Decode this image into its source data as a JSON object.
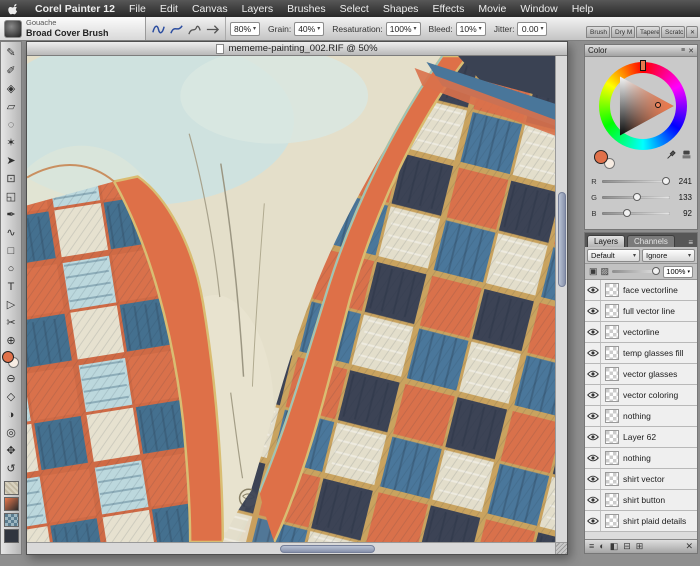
{
  "menu_bar": {
    "app_name": "Corel Painter 12",
    "items": [
      "File",
      "Edit",
      "Canvas",
      "Layers",
      "Brushes",
      "Select",
      "Shapes",
      "Effects",
      "Movie",
      "Window",
      "Help"
    ]
  },
  "property_bar": {
    "brush_category": "Gouache",
    "brush_name": "Broad Cover Brush",
    "controls": [
      {
        "label": "",
        "value": "80%"
      },
      {
        "label": "Grain:",
        "value": "40%"
      },
      {
        "label": "Resaturation:",
        "value": "100%"
      },
      {
        "label": "Bleed:",
        "value": "10%"
      },
      {
        "label": "Jitter:",
        "value": "0.00"
      }
    ]
  },
  "dock_tabs": [
    "Brush",
    "Dry M",
    "Tapere",
    "Scratc"
  ],
  "toolbox": {
    "tools_upper": [
      {
        "name": "brush-tool",
        "glyph": "✎"
      },
      {
        "name": "dropper-tool",
        "glyph": "✐"
      },
      {
        "name": "paint-bucket-tool",
        "glyph": "◈"
      },
      {
        "name": "eraser-tool",
        "glyph": "▱"
      },
      {
        "name": "lasso-tool",
        "glyph": "◌"
      },
      {
        "name": "magic-wand-tool",
        "glyph": "✶"
      },
      {
        "name": "layer-adjuster-tool",
        "glyph": "➤"
      },
      {
        "name": "transform-tool",
        "glyph": "⊡"
      },
      {
        "name": "crop-tool",
        "glyph": "◱"
      },
      {
        "name": "pen-tool",
        "glyph": "✒"
      },
      {
        "name": "quick-curve-tool",
        "glyph": "∿"
      },
      {
        "name": "rect-shape-tool",
        "glyph": "□"
      },
      {
        "name": "oval-shape-tool",
        "glyph": "○"
      },
      {
        "name": "text-tool",
        "glyph": "T"
      },
      {
        "name": "shape-selection-tool",
        "glyph": "▷"
      },
      {
        "name": "scissors-tool",
        "glyph": "✂"
      },
      {
        "name": "add-point-tool",
        "glyph": "⊕"
      }
    ],
    "tools_lower": [
      {
        "name": "remove-point-tool",
        "glyph": "⊖"
      },
      {
        "name": "convert-point-tool",
        "glyph": "◇"
      },
      {
        "name": "mirror-painting-tool",
        "glyph": "◑"
      },
      {
        "name": "magnifier-tool",
        "glyph": "◎"
      },
      {
        "name": "grabber-hand-tool",
        "glyph": "✥"
      },
      {
        "name": "rotate-page-tool",
        "glyph": "↺"
      }
    ],
    "selectors": [
      {
        "name": "paper-selector"
      },
      {
        "name": "gradient-selector"
      },
      {
        "name": "pattern-selector"
      },
      {
        "name": "nozzle-selector"
      }
    ]
  },
  "canvas_window": {
    "title": "mememe-painting_002.RIF @ 50%"
  },
  "color_panel": {
    "title": "Color",
    "max": 255,
    "sliders": [
      {
        "label": "R",
        "value": 241
      },
      {
        "label": "G",
        "value": 133
      },
      {
        "label": "B",
        "value": 92
      }
    ]
  },
  "layers_panel": {
    "tabs": [
      "Layers",
      "Channels"
    ],
    "composite_method": "Default",
    "composite_depth": "Ignore",
    "opacity": "100%",
    "lock_icons": [
      {
        "name": "preserve-transparency-icon",
        "glyph": "▣"
      },
      {
        "name": "pickup-underlying-icon",
        "glyph": "▨"
      }
    ],
    "bottom_icons": [
      {
        "name": "panel-menu-icon",
        "glyph": "≡"
      },
      {
        "name": "dynamic-plugins-icon",
        "glyph": "◐"
      },
      {
        "name": "layer-mask-icon",
        "glyph": "◧"
      },
      {
        "name": "new-group-icon",
        "glyph": "⊟"
      },
      {
        "name": "new-layer-icon",
        "glyph": "⊞"
      },
      {
        "name": "delete-layer-icon",
        "glyph": "✕"
      }
    ],
    "layers": [
      {
        "name": "face vectorline"
      },
      {
        "name": "full vector line"
      },
      {
        "name": "vectorline"
      },
      {
        "name": "temp glasses fill"
      },
      {
        "name": "vector glasses"
      },
      {
        "name": "vector coloring"
      },
      {
        "name": "nothing"
      },
      {
        "name": "Layer 62"
      },
      {
        "name": "nothing"
      },
      {
        "name": "shirt vector"
      },
      {
        "name": "shirt button"
      },
      {
        "name": "shirt plaid details"
      }
    ]
  }
}
